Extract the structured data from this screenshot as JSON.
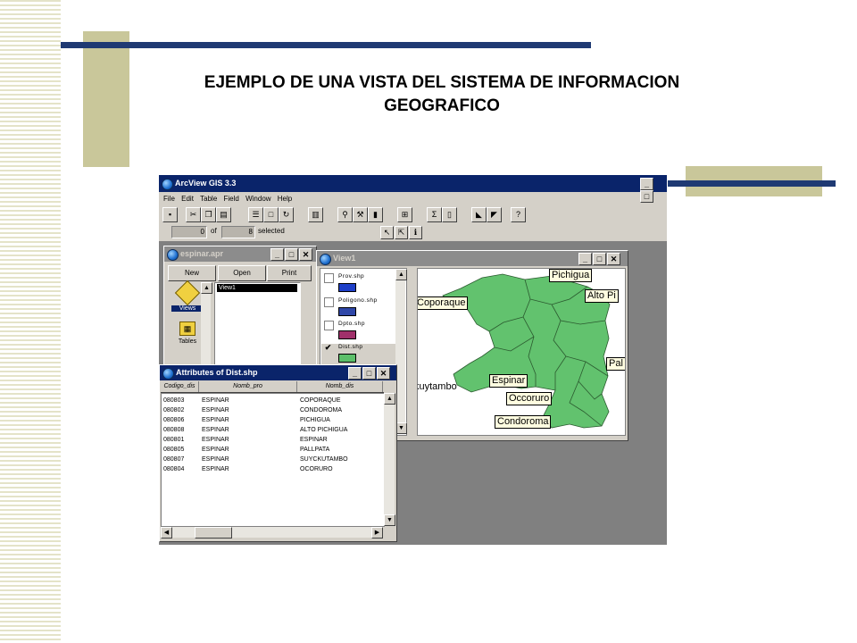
{
  "slide": {
    "title_line1": "EJEMPLO DE UNA VISTA DEL SISTEMA DE INFORMACION",
    "title_line2": "GEOGRAFICO"
  },
  "app": {
    "title": "ArcView GIS 3.3",
    "menu": [
      "File",
      "Edit",
      "Table",
      "Field",
      "Window",
      "Help"
    ],
    "selection": {
      "count": "0",
      "of_label": "of",
      "total": "8",
      "selected_label": "selected"
    }
  },
  "project_window": {
    "title": "espinar.apr",
    "buttons": {
      "new": "New",
      "open": "Open",
      "print": "Print"
    },
    "categories": [
      "Views",
      "Tables"
    ],
    "list_items": [
      "View1"
    ]
  },
  "view_window": {
    "title": "View1",
    "legend": [
      {
        "name": "Prov.shp",
        "checked": false,
        "color": "#1e3fc8"
      },
      {
        "name": "Poligono.shp",
        "checked": false,
        "color": "#2f47a8"
      },
      {
        "name": "Dpto.shp",
        "checked": false,
        "color": "#a0306a"
      },
      {
        "name": "Dist.shp",
        "checked": true,
        "color": "#5cbf6a"
      }
    ],
    "map_labels": [
      "Pichigua",
      "Coporaque",
      "Alto Pi",
      "Pal",
      "Espinar",
      "kuytambo",
      "Occoruro",
      "Condoroma"
    ],
    "map_color": "#62c26e"
  },
  "attributes_window": {
    "title": "Attributes of Dist.shp",
    "columns": [
      "Codigo_dis",
      "Nomb_pro",
      "Nomb_dis"
    ],
    "rows": [
      [
        "080803",
        "ESPINAR",
        "COPORAQUE"
      ],
      [
        "080802",
        "ESPINAR",
        "CONDOROMA"
      ],
      [
        "080806",
        "ESPINAR",
        "PICHIGUA"
      ],
      [
        "080808",
        "ESPINAR",
        "ALTO PICHIGUA"
      ],
      [
        "080801",
        "ESPINAR",
        "ESPINAR"
      ],
      [
        "080805",
        "ESPINAR",
        "PALLPATA"
      ],
      [
        "080807",
        "ESPINAR",
        "SUYCKUTAMBO"
      ],
      [
        "080804",
        "ESPINAR",
        "OCORURO"
      ]
    ]
  },
  "colors": {
    "title_bar": "#0a246a",
    "accent_bar": "#1f3a73",
    "deco": "#c9c79a"
  }
}
